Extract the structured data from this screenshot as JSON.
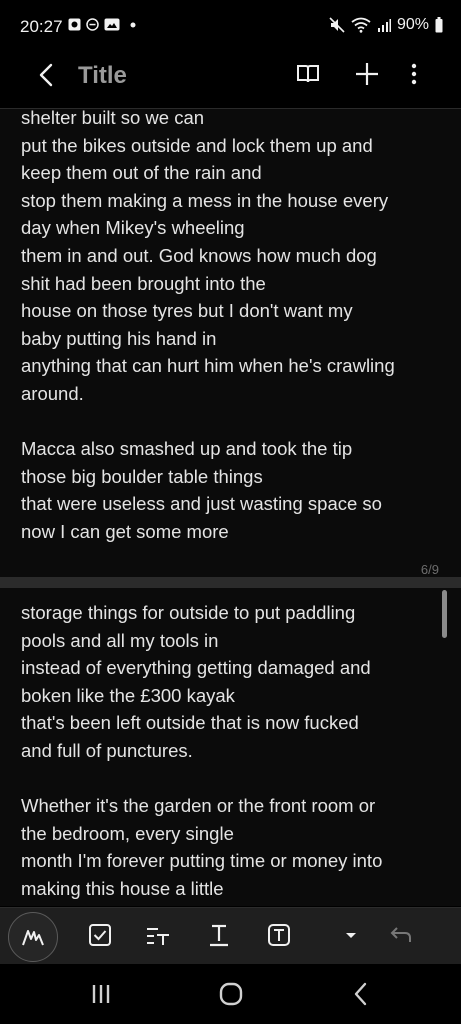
{
  "status": {
    "time": "20:27",
    "battery": "90%",
    "icons": [
      "message-icon",
      "do-not-disturb-icon",
      "gallery-icon",
      "dot-icon",
      "mute-icon",
      "wifi-icon",
      "signal-icon",
      "battery-icon"
    ]
  },
  "appbar": {
    "title": "Title",
    "icons": [
      "back-icon",
      "book-icon",
      "add-icon",
      "more-icon"
    ]
  },
  "page1": {
    "lines": [
      "shelter built so we can",
      "put the bikes outside and lock them up and",
      "keep them out of the rain and",
      "stop them making a mess in the house every",
      "day when Mikey's wheeling",
      "them in and out. God knows how much dog",
      "shit had been brought into the",
      "house on those tyres but I don't want my",
      "baby putting his hand in",
      "anything that can hurt him when he's crawling",
      "around.",
      "",
      "Macca also smashed up and took the tip",
      "those big boulder table things",
      "that were useless and just wasting space so",
      "now I can get some more"
    ],
    "page_number": "6/9"
  },
  "page2": {
    "lines": [
      "storage things for outside to put paddling",
      "pools and all my tools in",
      "instead of everything getting damaged and",
      "boken like the £300 kayak",
      "that's been left outside that is now fucked",
      "and full of punctures.",
      "",
      "Whether it's the garden or the front room or",
      "the bedroom, every single",
      "month I'm forever putting time or money into",
      "making this house a little"
    ]
  },
  "toolbar": {
    "icons": [
      "pen-mode-icon",
      "checkbox-icon",
      "text-style-icon",
      "underline-text-icon",
      "text-box-icon",
      "dropdown-icon",
      "undo-icon"
    ]
  },
  "navbar": {
    "icons": [
      "recents-icon",
      "home-icon",
      "back-nav-icon"
    ]
  },
  "colors": {
    "background": "#000000",
    "page": "#0b0b0b",
    "toolbar": "#1f1f1f",
    "text": "#e4e4e4",
    "title": "#9a9a9a"
  }
}
